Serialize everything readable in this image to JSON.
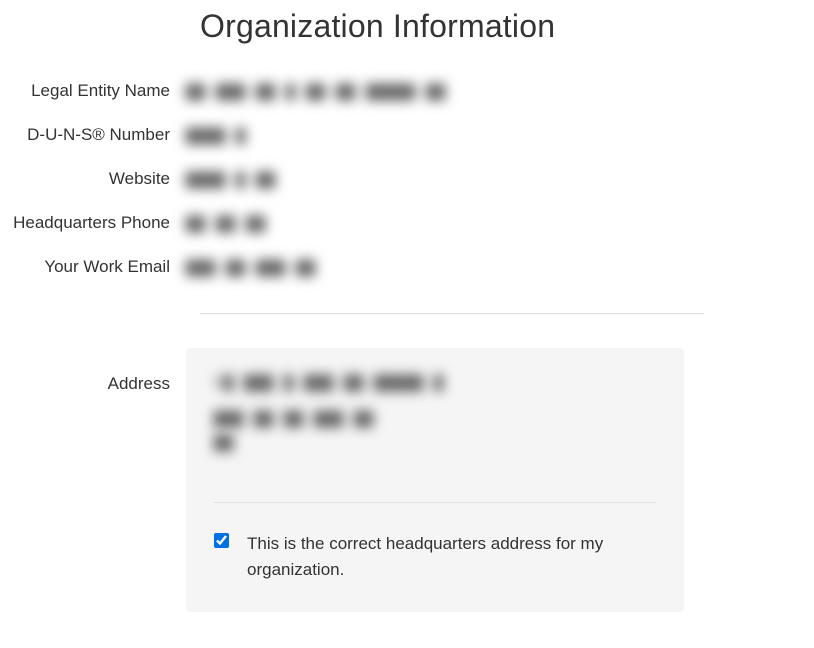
{
  "title": "Organization Information",
  "fields": {
    "legalEntityName": {
      "label": "Legal Entity Name",
      "value": "██ ███ ██ █ ██ ██ █████ ██"
    },
    "dunsNumber": {
      "label": "D-U-N-S® Number",
      "value": "████ █"
    },
    "website": {
      "label": "Website",
      "value": "████ █ ██"
    },
    "hqPhone": {
      "label": "Headquarters Phone",
      "value": "██ ██ ██"
    },
    "workEmail": {
      "label": "Your Work Email",
      "value": "███ ██ ███ ██"
    }
  },
  "address": {
    "label": "Address",
    "lines": [
      "R█ ███ █ ███ ██ █████ █",
      "███ ██ ██ ███ ██",
      "██"
    ],
    "confirmLabel": "This is the correct headquarters address for my organization.",
    "confirmChecked": true
  }
}
